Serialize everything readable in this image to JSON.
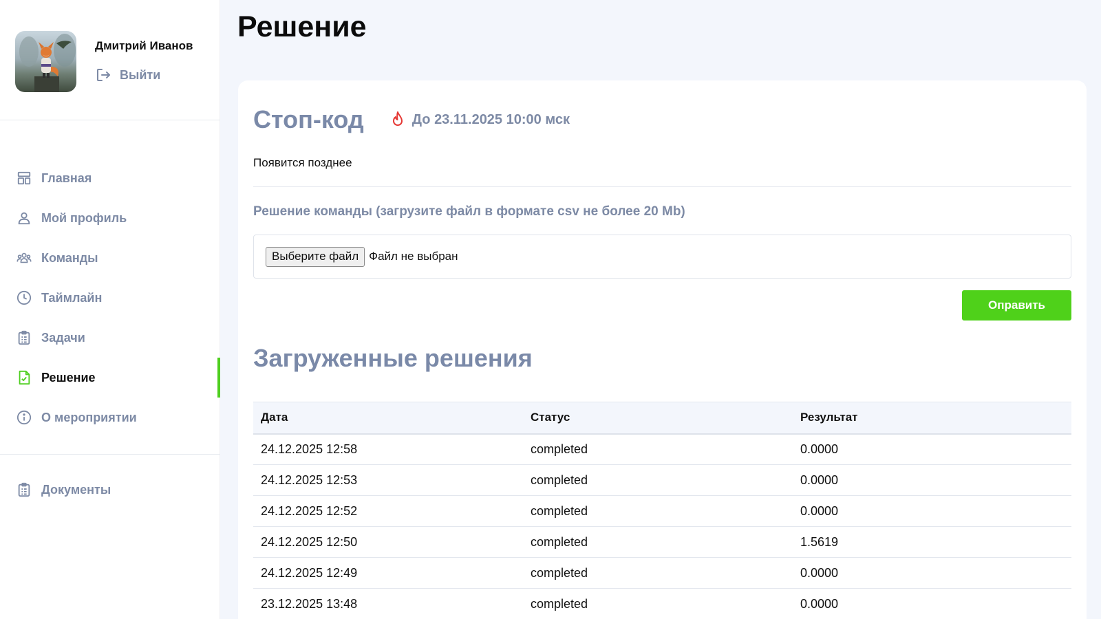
{
  "user": {
    "name": "Дмитрий Иванов",
    "logout_label": "Выйти"
  },
  "nav": {
    "items": [
      {
        "label": "Главная",
        "icon": "home-dashboard-icon"
      },
      {
        "label": "Мой профиль",
        "icon": "user-icon"
      },
      {
        "label": "Команды",
        "icon": "team-icon"
      },
      {
        "label": "Таймлайн",
        "icon": "clock-icon"
      },
      {
        "label": "Задачи",
        "icon": "clipboard-icon"
      },
      {
        "label": "Решение",
        "icon": "document-check-icon",
        "active": true
      },
      {
        "label": "О мероприятии",
        "icon": "info-icon"
      }
    ],
    "docs_label": "Документы"
  },
  "page": {
    "title": "Решение"
  },
  "stop_code": {
    "title": "Стоп-код",
    "deadline": "До 23.11.2025 10:00 мск",
    "note": "Появится позднее"
  },
  "upload": {
    "label": "Решение команды (загрузите файл в формате csv не более 20 Mb)",
    "choose_button": "Выберите файл",
    "no_file": "Файл не выбран",
    "submit_label": "Оправить"
  },
  "uploaded": {
    "title": "Загруженные решения",
    "columns": [
      "Дата",
      "Статус",
      "Результат"
    ],
    "rows": [
      [
        "24.12.2025 12:58",
        "completed",
        "0.0000"
      ],
      [
        "24.12.2025 12:53",
        "completed",
        "0.0000"
      ],
      [
        "24.12.2025 12:52",
        "completed",
        "0.0000"
      ],
      [
        "24.12.2025 12:50",
        "completed",
        "1.5619"
      ],
      [
        "24.12.2025 12:49",
        "completed",
        "0.0000"
      ],
      [
        "23.12.2025 13:48",
        "completed",
        "0.0000"
      ]
    ]
  },
  "colors": {
    "accent": "#4fd11a",
    "muted": "#7d8aa5",
    "flame": "#e53935"
  }
}
